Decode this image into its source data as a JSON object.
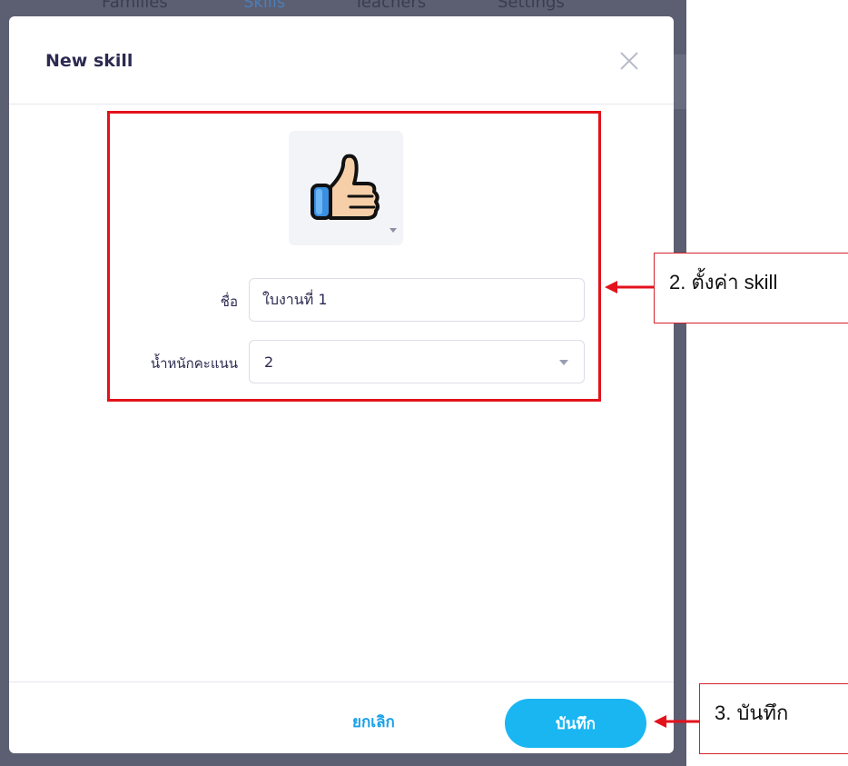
{
  "background_nav": [
    "Families",
    "Skills",
    "Teachers",
    "Settings"
  ],
  "modal": {
    "title": "New skill",
    "close_icon": "close-icon",
    "skill_icon": "thumbs-up-icon",
    "name_label": "ชื่อ",
    "name_value": "ใบงานที่ 1",
    "weight_label": "น้ำหนักคะแนน",
    "weight_value": "2",
    "cancel_label": "ยกเลิก",
    "save_label": "บันทึก"
  },
  "annotations": {
    "step2": "2. ตั้งค่า skill",
    "step3": "3. บันทึก",
    "highlight_color": "#e3121b"
  },
  "colors": {
    "primary": "#1ab6f2",
    "link": "#1aa0e8",
    "title": "#2c2a50",
    "overlay": "#5c5e72"
  }
}
